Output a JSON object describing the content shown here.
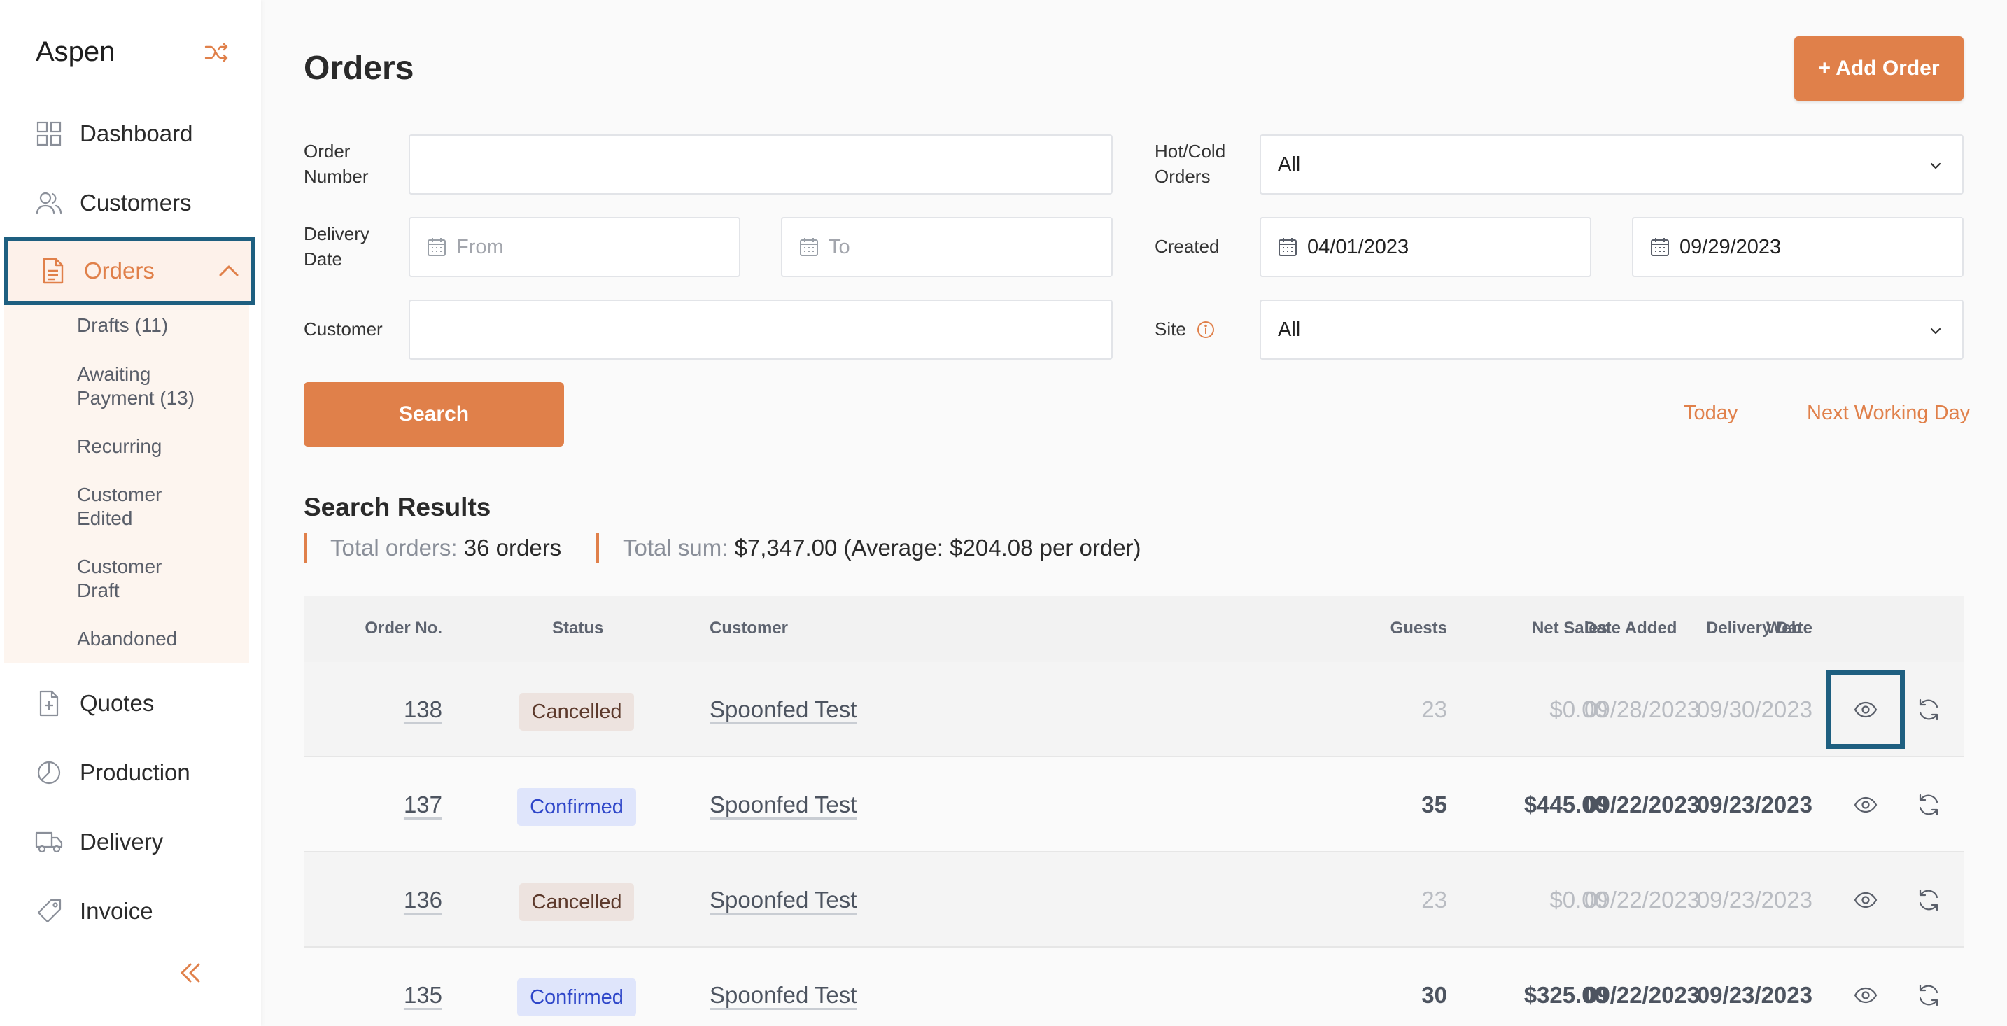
{
  "app": {
    "brand": "Aspen"
  },
  "theme": {
    "accent": "#e0804a",
    "highlight": "#1e5f80",
    "sidebar_active_bg": "#fdf1ea"
  },
  "sidebar": {
    "items": [
      {
        "label": "Dashboard",
        "icon": "grid-icon"
      },
      {
        "label": "Customers",
        "icon": "users-icon"
      },
      {
        "label": "Orders",
        "icon": "document-icon",
        "active": true
      },
      {
        "label": "Quotes",
        "icon": "file-plus-icon"
      },
      {
        "label": "Production",
        "icon": "pie-chart-icon"
      },
      {
        "label": "Delivery",
        "icon": "truck-icon"
      },
      {
        "label": "Invoice",
        "icon": "tag-icon"
      }
    ],
    "orders_submenu": [
      {
        "line1": "Drafts (11)",
        "line2": ""
      },
      {
        "line1": "Awaiting",
        "line2": "Payment (13)"
      },
      {
        "line1": "Recurring",
        "line2": ""
      },
      {
        "line1": "Customer",
        "line2": "Edited"
      },
      {
        "line1": "Customer",
        "line2": "Draft"
      },
      {
        "line1": "Abandoned",
        "line2": ""
      }
    ]
  },
  "header": {
    "title": "Orders",
    "add_button": "+ Add Order"
  },
  "filters": {
    "order_number": {
      "label1": "Order",
      "label2": "Number",
      "value": ""
    },
    "delivery_date": {
      "label1": "Delivery",
      "label2": "Date",
      "from_placeholder": "From",
      "to_placeholder": "To"
    },
    "customer": {
      "label": "Customer",
      "value": ""
    },
    "hot_cold": {
      "label1": "Hot/Cold",
      "label2": "Orders",
      "value": "All"
    },
    "created": {
      "label": "Created",
      "from": "04/01/2023",
      "to": "09/29/2023"
    },
    "site": {
      "label": "Site",
      "value": "All"
    },
    "search_button": "Search",
    "today_link": "Today",
    "next_working_day_link": "Next Working Day"
  },
  "results": {
    "title": "Search Results",
    "total_orders_label": "Total orders:",
    "total_orders_value": "36 orders",
    "total_sum_label": "Total sum:",
    "total_sum_value": "$7,347.00 (Average: $204.08 per order)"
  },
  "table": {
    "columns": [
      "Order No.",
      "Status",
      "Customer",
      "Guests",
      "Net Sales",
      "Delivery Date",
      "Date Added",
      "Web"
    ],
    "rows": [
      {
        "order_no": "138",
        "status": "Cancelled",
        "customer": "Spoonfed Test",
        "guests": "23",
        "net_sales": "$0.00",
        "delivery_date": "09/30/2023",
        "date_added": "09/28/2023"
      },
      {
        "order_no": "137",
        "status": "Confirmed",
        "customer": "Spoonfed Test",
        "guests": "35",
        "net_sales": "$445.00",
        "delivery_date": "09/23/2023",
        "date_added": "09/22/2023"
      },
      {
        "order_no": "136",
        "status": "Cancelled",
        "customer": "Spoonfed Test",
        "guests": "23",
        "net_sales": "$0.00",
        "delivery_date": "09/23/2023",
        "date_added": "09/22/2023"
      },
      {
        "order_no": "135",
        "status": "Confirmed",
        "customer": "Spoonfed Test",
        "guests": "30",
        "net_sales": "$325.00",
        "delivery_date": "09/23/2023",
        "date_added": "09/22/2023"
      }
    ]
  }
}
